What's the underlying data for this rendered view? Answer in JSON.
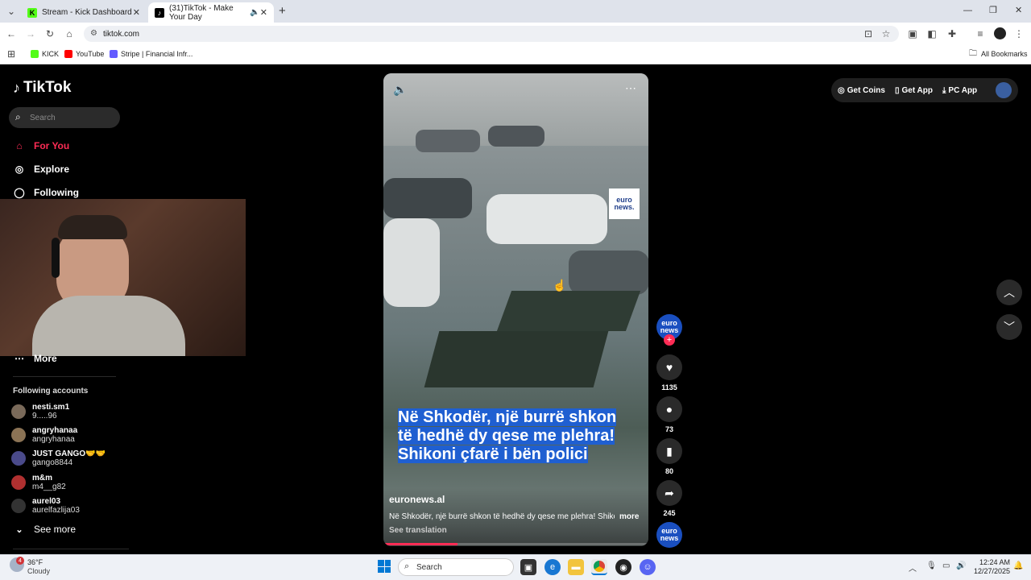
{
  "browser": {
    "tabs": [
      {
        "label": "Stream - Kick Dashboard",
        "active": false
      },
      {
        "label": "(31)TikTok - Make Your Day",
        "active": true
      }
    ],
    "new_tab": "+",
    "url": "tiktok.com",
    "bookmarks": [
      "KICK",
      "YouTube",
      "Stripe | Financial Infr..."
    ],
    "all_bookmarks": "All Bookmarks"
  },
  "tiktok": {
    "logo": "TikTok",
    "search_placeholder": "Search",
    "nav": [
      {
        "label": "For You",
        "icon": "home-icon",
        "active": true
      },
      {
        "label": "Explore",
        "icon": "compass-icon",
        "active": false
      },
      {
        "label": "Following",
        "icon": "following-icon",
        "active": false
      },
      {
        "label": "More",
        "icon": "more-icon",
        "active": false
      }
    ],
    "following_header": "Following accounts",
    "accounts": [
      {
        "name": "nesti.sm1",
        "handle": "9.....96",
        "color": "#7a6a5a"
      },
      {
        "name": "angryhanaa",
        "handle": "angryhanaa",
        "color": "#8b7355"
      },
      {
        "name": "JUST GANGO🤝🤝",
        "handle": "gango8844",
        "color": "#4a4a8a"
      },
      {
        "name": "m&m",
        "handle": "m4__g82",
        "color": "#b03030"
      },
      {
        "name": "aurel03",
        "handle": "aurelfazlija03",
        "color": "#333333"
      }
    ],
    "see_more": "See more",
    "topbar": {
      "get_coins": "Get Coins",
      "get_app": "Get App",
      "pc_app": "PC App"
    },
    "video": {
      "watermark": "euro news.",
      "caption_lines": [
        "Në Shkodër, një burrë shkon",
        "të hedhë dy qese me plehra!",
        "Shikoni çfarë i bën polici"
      ],
      "author": "euronews.al",
      "description": "Në Shkodër, një burrë shkon të hedhë dy qese me plehra! Shikoni",
      "more": "more",
      "see_translation": "See translation",
      "progress": 0.28
    },
    "actions": {
      "avatar_label": "euro news",
      "likes": "1135",
      "comments": "73",
      "saves": "80",
      "shares": "245"
    }
  },
  "taskbar": {
    "weather_temp": "36°F",
    "weather_desc": "Cloudy",
    "weather_badge": "4",
    "search_placeholder": "Search",
    "time": "12:24 AM",
    "date": "12/27/2025"
  },
  "colors": {
    "tiktok_red": "#fe2c55",
    "caption_bg": "#1f5fd1"
  }
}
